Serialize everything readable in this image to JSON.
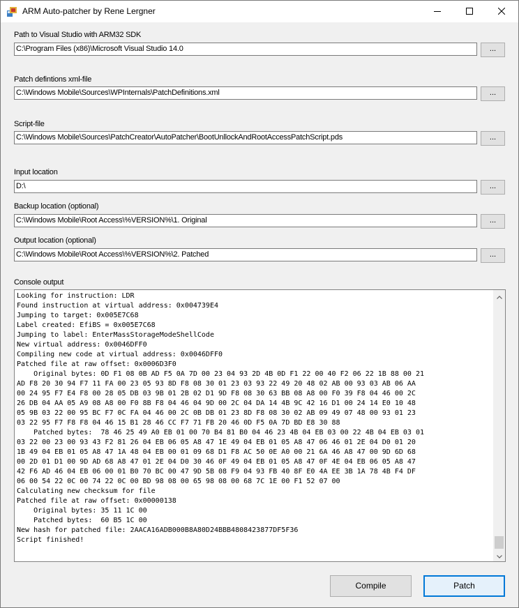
{
  "window": {
    "title": "ARM Auto-patcher by Rene Lergner"
  },
  "fields": [
    {
      "label": "Path to Visual Studio with ARM32 SDK",
      "value": "C:\\Program Files (x86)\\Microsoft Visual Studio 14.0",
      "browse": "..."
    },
    {
      "label": "Patch defintions xml-file",
      "value": "C:\\Windows Mobile\\Sources\\WPInternals\\PatchDefinitions.xml",
      "browse": "..."
    },
    {
      "label": "Script-file",
      "value": "C:\\Windows Mobile\\Sources\\PatchCreator\\AutoPatcher\\BootUnllockAndRootAccessPatchScript.pds",
      "browse": "..."
    },
    {
      "label": "Input location",
      "value": "D:\\",
      "browse": "..."
    },
    {
      "label": "Backup location (optional)",
      "value": "C:\\Windows Mobile\\Root Access\\%VERSION%\\1. Original",
      "browse": "..."
    },
    {
      "label": "Output location (optional)",
      "value": "C:\\Windows Mobile\\Root Access\\%VERSION%\\2. Patched",
      "browse": "..."
    }
  ],
  "console": {
    "label": "Console output",
    "text": "Looking for instruction: LDR\nFound instruction at virtual address: 0x004739E4\nJumping to target: 0x005E7C68\nLabel created: EfiBS = 0x005E7C68\nJumping to label: EnterMassStorageModeShellCode\nNew virtual address: 0x0046DFF0\nCompiling new code at virtual address: 0x0046DFF0\nPatched file at raw offset: 0x0006D3F0\n    Original bytes: 0D F1 08 0B AD F5 0A 7D 00 23 04 93 2D 4B 0D F1 22 00 40 F2 06 22 1B 88 00 21\nAD F8 20 30 94 F7 11 FA 00 23 05 93 8D F8 08 30 01 23 03 93 22 49 20 48 02 AB 00 93 03 AB 06 AA\n00 24 95 F7 E4 F8 00 28 05 DB 03 9B 01 2B 02 D1 9D F8 08 30 63 BB 08 A8 00 F0 39 F8 04 46 00 2C\n26 DB 04 AA 05 A9 08 A8 00 F0 8B F8 04 46 04 9D 00 2C 04 DA 14 4B 9C 42 16 D1 00 24 14 E0 10 48\n05 9B 03 22 00 95 BC F7 0C FA 04 46 00 2C 0B DB 01 23 8D F8 08 30 02 AB 09 49 07 48 00 93 01 23\n03 22 95 F7 F8 F8 04 46 15 B1 28 46 CC F7 71 FB 20 46 0D F5 0A 7D BD E8 30 88\n    Patched bytes:  78 46 25 49 A0 EB 01 00 70 B4 81 B0 04 46 23 4B 04 EB 03 00 22 4B 04 EB 03 01\n03 22 00 23 00 93 43 F2 81 26 04 EB 06 05 A8 47 1E 49 04 EB 01 05 A8 47 06 46 01 2E 04 D0 01 20\n1B 49 04 EB 01 05 A8 47 1A 48 04 EB 00 01 09 68 D1 F8 AC 50 0E A0 00 21 6A 46 A8 47 00 9D 6D 68\n00 2D 01 D1 00 9D AD 68 A8 47 01 2E 04 D0 30 46 0F 49 04 EB 01 05 A8 47 0F 4E 04 EB 06 05 A8 47\n42 F6 AD 46 04 EB 06 00 01 B0 70 BC 00 47 9D 5B 08 F9 04 93 FB 40 8F E0 4A EE 3B 1A 78 4B F4 DF\n06 00 54 22 0C 00 74 22 0C 00 BD 98 08 00 65 98 08 00 68 7C 1E 00 F1 52 07 00\nCalculating new checksum for file\nPatched file at raw offset: 0x00000138\n    Original bytes: 35 11 1C 00\n    Patched bytes:  60 B5 1C 00\nNew hash for patched file: 2AACA16ADB000B8A80D24BBB4808423877DF5F36\nScript finished!"
  },
  "buttons": {
    "compile": "Compile",
    "patch": "Patch"
  },
  "colors": {
    "accent": "#0078d7",
    "window_bg": "#f0f0f0",
    "button_bg": "#e1e1e1"
  }
}
